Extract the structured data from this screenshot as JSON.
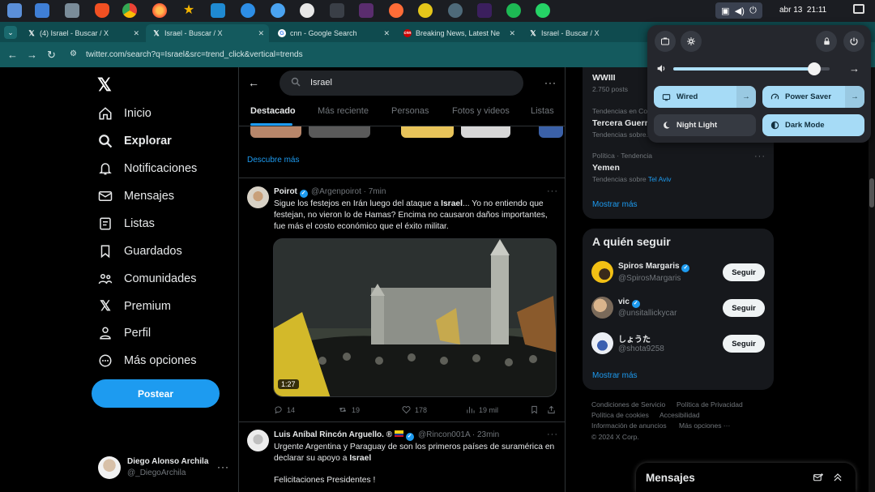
{
  "os_panel": {
    "date": "abr 13",
    "time": "21:11"
  },
  "browser": {
    "tabs": [
      {
        "label": "(4) Israel - Buscar / X",
        "favicon": "X",
        "active": false
      },
      {
        "label": "Israel - Buscar / X",
        "favicon": "X",
        "active": true
      },
      {
        "label": "cnn - Google Search",
        "favicon": "G",
        "active": false
      },
      {
        "label": "Breaking News, Latest Ne",
        "favicon": "cnn",
        "active": false
      },
      {
        "label": "Israel - Buscar / X",
        "favicon": "X",
        "active": false
      }
    ],
    "url": "twitter.com/search?q=Israel&src=trend_click&vertical=trends"
  },
  "left_nav": {
    "items": [
      {
        "label": "Inicio",
        "icon": "home-icon"
      },
      {
        "label": "Explorar",
        "icon": "search-icon",
        "active": true
      },
      {
        "label": "Notificaciones",
        "icon": "bell-icon"
      },
      {
        "label": "Mensajes",
        "icon": "mail-icon"
      },
      {
        "label": "Listas",
        "icon": "list-icon"
      },
      {
        "label": "Guardados",
        "icon": "bookmark-icon"
      },
      {
        "label": "Comunidades",
        "icon": "people-icon"
      },
      {
        "label": "Premium",
        "icon": "x-icon"
      },
      {
        "label": "Perfil",
        "icon": "person-icon"
      },
      {
        "label": "Más opciones",
        "icon": "more-circle-icon"
      }
    ],
    "post_label": "Postear",
    "user": {
      "name": "Diego Alonso Archila",
      "handle": "@_DiegoArchila"
    }
  },
  "search": {
    "query": "Israel",
    "tabs": [
      "Destacado",
      "Más reciente",
      "Personas",
      "Fotos y videos",
      "Listas"
    ],
    "discover_more": "Descubre más"
  },
  "tweets": [
    {
      "name": "Poirot",
      "verified": true,
      "handle": "@Argenpoirot",
      "time": "7min",
      "text_before": "Sigue los festejos en Irán luego del ataque a ",
      "text_bold": "Israel",
      "text_after": "... Yo no entiendo que festejan, no vieron lo de Hamas? Encima no causaron daños importantes, fue más el costo económico que el éxito militar.",
      "media_duration": "1:27",
      "replies": "14",
      "retweets": "19",
      "likes": "178",
      "views": "19 mil"
    },
    {
      "name": "Luis Aníbal Rincón Arguello. ®",
      "verified": true,
      "handle": "@Rincon001A",
      "time": "23min",
      "text_before": "Urgente Argentina y Paraguay de son los primeros países de suramérica en declarar su apoyo a ",
      "text_bold": "Israel",
      "text_after": "",
      "text_line2": "Felicitaciones Presidentes !"
    }
  ],
  "trends": [
    {
      "title": "WWIII",
      "sub": "2.750 posts"
    },
    {
      "context": "Tendencias en Co...",
      "title": "Tercera Guerr...",
      "sub": "Tendencias sobre..."
    },
    {
      "context": "Política · Tendencia",
      "title": "Yemen",
      "sub_prefix": "Tendencias sobre ",
      "sub_link": "Tel Aviv"
    }
  ],
  "show_more": "Mostrar más",
  "who_to_follow": {
    "title": "A quién seguir",
    "follow_label": "Seguir",
    "accounts": [
      {
        "name": "Spiros Margaris",
        "verified": true,
        "handle": "@SpirosMargaris"
      },
      {
        "name": "vic",
        "verified": true,
        "handle": "@unsitallickycar"
      },
      {
        "name": "しょうた",
        "verified": false,
        "handle": "@shota9258"
      }
    ],
    "show_more": "Mostrar más"
  },
  "footer": {
    "links": [
      "Condiciones de Servicio",
      "Política de Privacidad",
      "Política de cookies",
      "Accesibilidad",
      "Información de anuncios",
      "Más opciones ···"
    ],
    "copyright": "© 2024 X Corp."
  },
  "messages_drawer": {
    "title": "Mensajes"
  },
  "quick_settings": {
    "volume_percent": 90,
    "tiles": [
      {
        "label": "Wired",
        "state": "on",
        "icon": "network-icon"
      },
      {
        "label": "Power Saver",
        "state": "on",
        "icon": "gauge-icon"
      },
      {
        "label": "Night Light",
        "state": "off",
        "icon": "moon-icon"
      },
      {
        "label": "Dark Mode",
        "state": "on",
        "icon": "contrast-icon"
      }
    ]
  },
  "colors": {
    "accent": "#1d9bf0",
    "tab_bar": "#0f4b4f",
    "qs_active": "#a6dbf6"
  }
}
